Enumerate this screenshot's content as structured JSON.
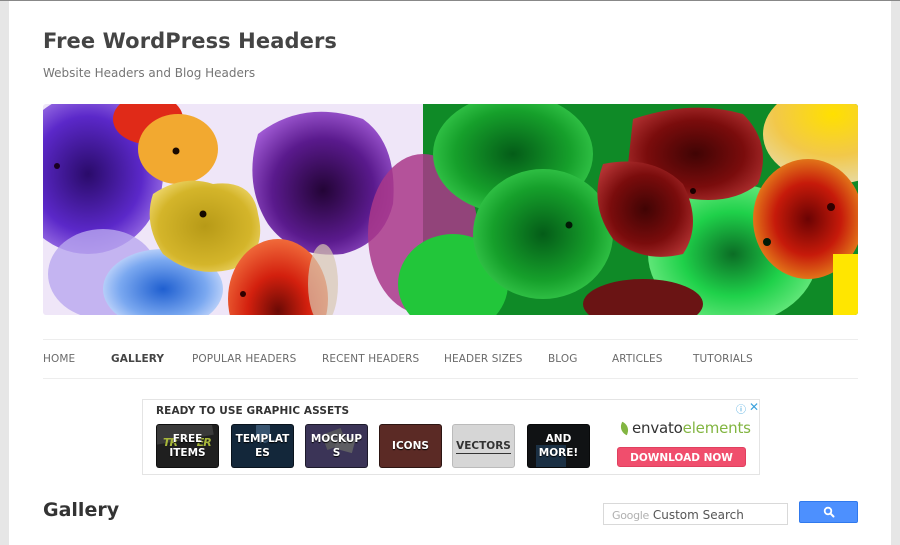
{
  "site": {
    "title": "Free WordPress Headers",
    "description": "Website Headers and Blog Headers"
  },
  "banner": {
    "alt": "Colorful blown glass flowers header image"
  },
  "nav": {
    "items": [
      {
        "label": "HOME",
        "active": false
      },
      {
        "label": "GALLERY",
        "active": true
      },
      {
        "label": "POPULAR HEADERS",
        "active": false
      },
      {
        "label": "RECENT HEADERS",
        "active": false
      },
      {
        "label": "HEADER SIZES",
        "active": false
      },
      {
        "label": "BLOG",
        "active": false
      },
      {
        "label": "ARTICLES",
        "active": false
      },
      {
        "label": "TUTORIALS",
        "active": false
      }
    ]
  },
  "ad": {
    "title": "READY TO USE GRAPHIC ASSETS",
    "tiles": [
      {
        "line1": "FREE",
        "line2": "ITEMS",
        "bg": "#1f1f1f"
      },
      {
        "line1": "TEMPLAT",
        "line2": "ES",
        "bg": "#13273a"
      },
      {
        "line1": "MOCKUP",
        "line2": "S",
        "bg": "#3b3457"
      },
      {
        "line1": "ICONS",
        "line2": "",
        "bg": "#5b2a25"
      },
      {
        "line1": "VECTORS",
        "line2": "",
        "bg": "#d6d6d6"
      },
      {
        "line1": "AND",
        "line2": "MORE!",
        "bg": "#101214"
      }
    ],
    "brand_part1": "envato",
    "brand_part2": "elements",
    "cta": "DOWNLOAD NOW",
    "info_icon": "ⓘ",
    "close_icon": "✕",
    "colors": {
      "cta": "#f04e6d",
      "brand_green": "#82b541",
      "adchoice": "#3ba1dc"
    }
  },
  "main": {
    "heading": "Gallery"
  },
  "search": {
    "google_label": "Google",
    "placeholder": "Custom Search",
    "button_icon": "search-icon"
  }
}
